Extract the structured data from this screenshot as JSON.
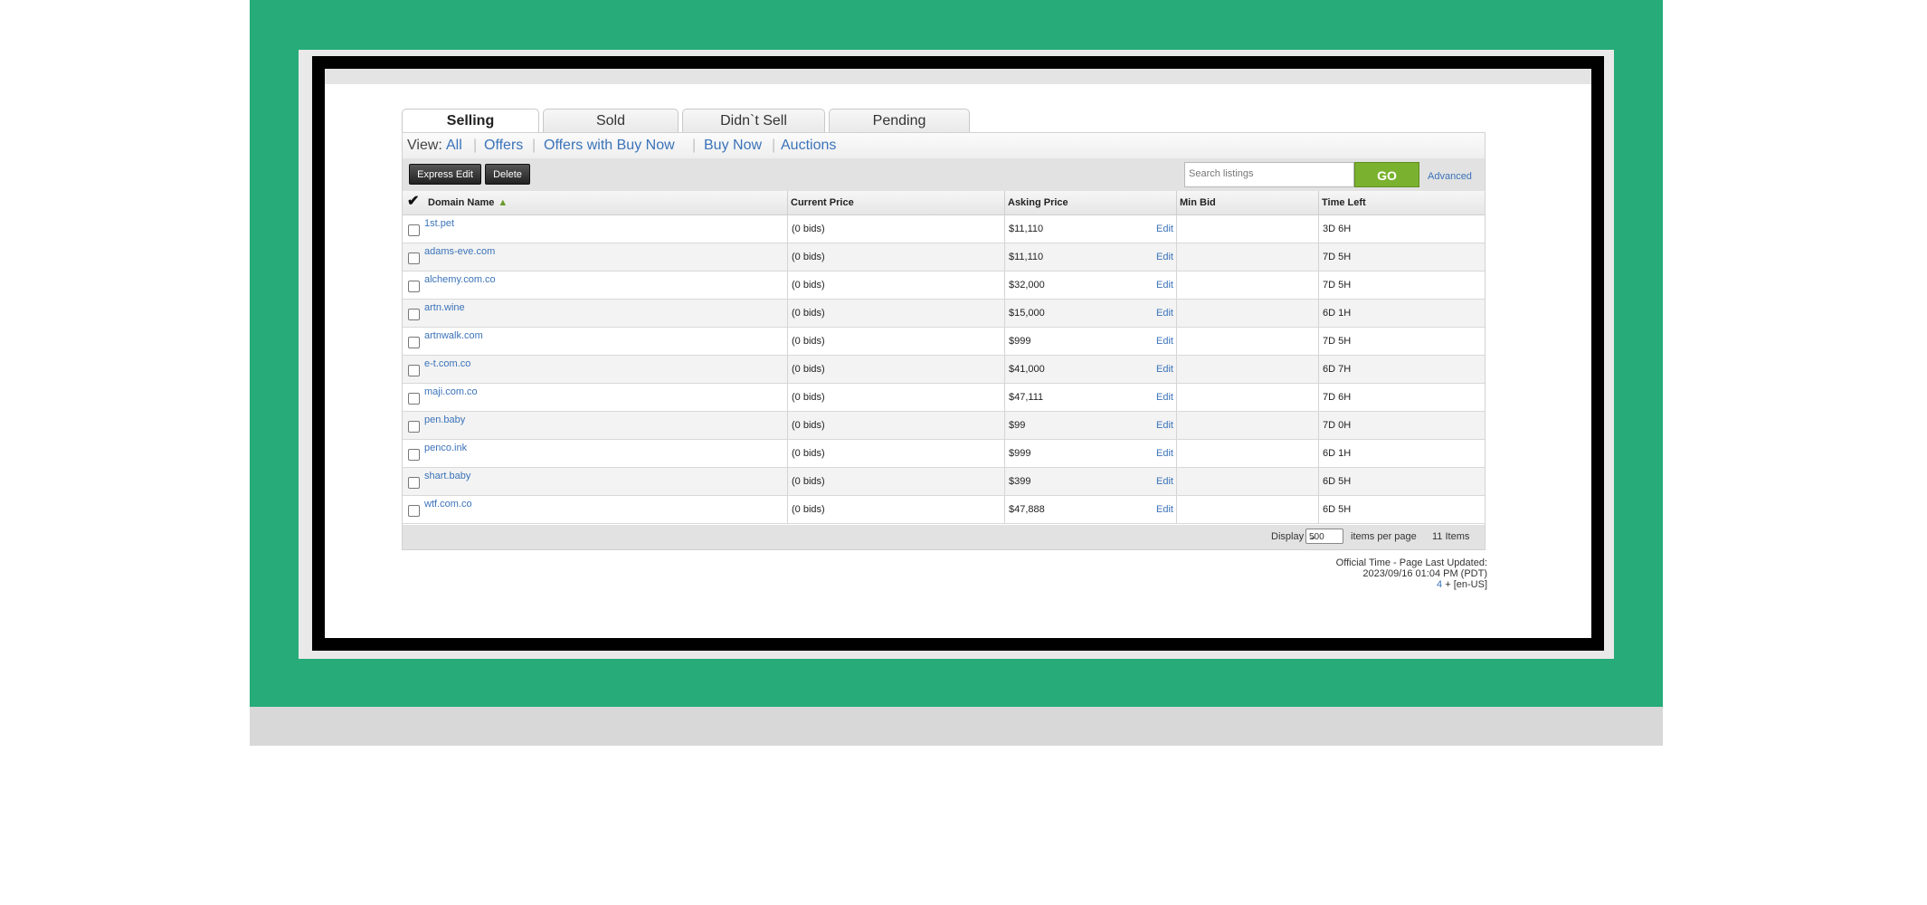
{
  "tabs": [
    "Selling",
    "Sold",
    "Didn`t Sell",
    "Pending"
  ],
  "view": {
    "label": "View:",
    "links": [
      "All",
      "Offers",
      "Offers with Buy Now",
      "Buy Now",
      "Auctions"
    ]
  },
  "toolbar": {
    "express_edit": "Express Edit",
    "delete": "Delete",
    "search_placeholder": "Search listings",
    "go": "GO",
    "advanced": "Advanced"
  },
  "columns": [
    "Domain Name",
    "Current Price",
    "Asking Price",
    "Min Bid",
    "Time Left"
  ],
  "rows": [
    {
      "domain": "1st.pet",
      "bids": "(0 bids)",
      "asking": "$11,110",
      "edit": "Edit",
      "min_bid": "",
      "time_left": "3D 6H"
    },
    {
      "domain": "adams-eve.com",
      "bids": "(0 bids)",
      "asking": "$11,110",
      "edit": "Edit",
      "min_bid": "",
      "time_left": "7D 5H"
    },
    {
      "domain": "alchemy.com.co",
      "bids": "(0 bids)",
      "asking": "$32,000",
      "edit": "Edit",
      "min_bid": "",
      "time_left": "7D 5H"
    },
    {
      "domain": "artn.wine",
      "bids": "(0 bids)",
      "asking": "$15,000",
      "edit": "Edit",
      "min_bid": "",
      "time_left": "6D 1H"
    },
    {
      "domain": "artnwalk.com",
      "bids": "(0 bids)",
      "asking": "$999",
      "edit": "Edit",
      "min_bid": "",
      "time_left": "7D 5H"
    },
    {
      "domain": "e-t.com.co",
      "bids": "(0 bids)",
      "asking": "$41,000",
      "edit": "Edit",
      "min_bid": "",
      "time_left": "6D 7H"
    },
    {
      "domain": "maji.com.co",
      "bids": "(0 bids)",
      "asking": "$47,111",
      "edit": "Edit",
      "min_bid": "",
      "time_left": "7D 6H"
    },
    {
      "domain": "pen.baby",
      "bids": "(0 bids)",
      "asking": "$99",
      "edit": "Edit",
      "min_bid": "",
      "time_left": "7D 0H"
    },
    {
      "domain": "penco.ink",
      "bids": "(0 bids)",
      "asking": "$999",
      "edit": "Edit",
      "min_bid": "",
      "time_left": "6D 1H"
    },
    {
      "domain": "shart.baby",
      "bids": "(0 bids)",
      "asking": "$399",
      "edit": "Edit",
      "min_bid": "",
      "time_left": "6D 5H"
    },
    {
      "domain": "wtf.com.co",
      "bids": "(0 bids)",
      "asking": "$47,888",
      "edit": "Edit",
      "min_bid": "",
      "time_left": "6D 5H"
    }
  ],
  "footer": {
    "display_label": "Display",
    "per_page": "500",
    "items_per_page_label": "items per page",
    "item_count": "11 Items"
  },
  "official": {
    "line1": "Official Time - Page Last Updated:",
    "line2": "2023/09/16 01:04 PM (PDT)",
    "line3_num": "4",
    "line3_rest": " + [en-US]"
  }
}
